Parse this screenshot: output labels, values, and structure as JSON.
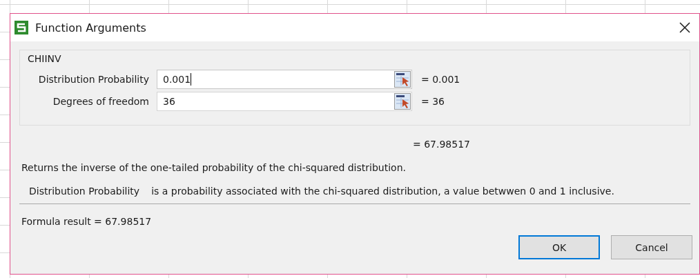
{
  "window": {
    "title": "Function Arguments"
  },
  "function_name": "CHIINV",
  "arguments": [
    {
      "label": "Distribution Probability",
      "value": "0.001",
      "evaluated": "= 0.001",
      "focused": true
    },
    {
      "label": "Degrees of freedom",
      "value": "36",
      "evaluated": "= 36",
      "focused": false
    }
  ],
  "function_value": "= 67.98517",
  "description": "Returns the inverse of the one-tailed probability of the chi-squared distribution.",
  "argument_help": {
    "name": "Distribution Probability",
    "text": "is a probability associated with the chi-squared distribution, a value betwwen 0 and 1 inclusive."
  },
  "formula_result": "Formula result  =  67.98517",
  "buttons": [
    {
      "label": "OK",
      "default": true
    },
    {
      "label": "Cancel",
      "default": false
    }
  ]
}
